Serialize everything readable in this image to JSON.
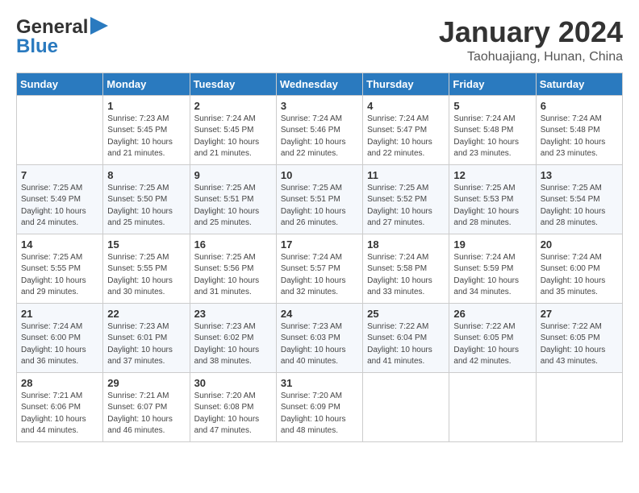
{
  "header": {
    "logo_general": "General",
    "logo_blue": "Blue",
    "month": "January 2024",
    "location": "Taohuajiang, Hunan, China"
  },
  "weekdays": [
    "Sunday",
    "Monday",
    "Tuesday",
    "Wednesday",
    "Thursday",
    "Friday",
    "Saturday"
  ],
  "weeks": [
    [
      {
        "num": "",
        "sunrise": "",
        "sunset": "",
        "daylight": ""
      },
      {
        "num": "1",
        "sunrise": "7:23 AM",
        "sunset": "5:45 PM",
        "daylight": "10 hours and 21 minutes."
      },
      {
        "num": "2",
        "sunrise": "7:24 AM",
        "sunset": "5:45 PM",
        "daylight": "10 hours and 21 minutes."
      },
      {
        "num": "3",
        "sunrise": "7:24 AM",
        "sunset": "5:46 PM",
        "daylight": "10 hours and 22 minutes."
      },
      {
        "num": "4",
        "sunrise": "7:24 AM",
        "sunset": "5:47 PM",
        "daylight": "10 hours and 22 minutes."
      },
      {
        "num": "5",
        "sunrise": "7:24 AM",
        "sunset": "5:48 PM",
        "daylight": "10 hours and 23 minutes."
      },
      {
        "num": "6",
        "sunrise": "7:24 AM",
        "sunset": "5:48 PM",
        "daylight": "10 hours and 23 minutes."
      }
    ],
    [
      {
        "num": "7",
        "sunrise": "7:25 AM",
        "sunset": "5:49 PM",
        "daylight": "10 hours and 24 minutes."
      },
      {
        "num": "8",
        "sunrise": "7:25 AM",
        "sunset": "5:50 PM",
        "daylight": "10 hours and 25 minutes."
      },
      {
        "num": "9",
        "sunrise": "7:25 AM",
        "sunset": "5:51 PM",
        "daylight": "10 hours and 25 minutes."
      },
      {
        "num": "10",
        "sunrise": "7:25 AM",
        "sunset": "5:51 PM",
        "daylight": "10 hours and 26 minutes."
      },
      {
        "num": "11",
        "sunrise": "7:25 AM",
        "sunset": "5:52 PM",
        "daylight": "10 hours and 27 minutes."
      },
      {
        "num": "12",
        "sunrise": "7:25 AM",
        "sunset": "5:53 PM",
        "daylight": "10 hours and 28 minutes."
      },
      {
        "num": "13",
        "sunrise": "7:25 AM",
        "sunset": "5:54 PM",
        "daylight": "10 hours and 28 minutes."
      }
    ],
    [
      {
        "num": "14",
        "sunrise": "7:25 AM",
        "sunset": "5:55 PM",
        "daylight": "10 hours and 29 minutes."
      },
      {
        "num": "15",
        "sunrise": "7:25 AM",
        "sunset": "5:55 PM",
        "daylight": "10 hours and 30 minutes."
      },
      {
        "num": "16",
        "sunrise": "7:25 AM",
        "sunset": "5:56 PM",
        "daylight": "10 hours and 31 minutes."
      },
      {
        "num": "17",
        "sunrise": "7:24 AM",
        "sunset": "5:57 PM",
        "daylight": "10 hours and 32 minutes."
      },
      {
        "num": "18",
        "sunrise": "7:24 AM",
        "sunset": "5:58 PM",
        "daylight": "10 hours and 33 minutes."
      },
      {
        "num": "19",
        "sunrise": "7:24 AM",
        "sunset": "5:59 PM",
        "daylight": "10 hours and 34 minutes."
      },
      {
        "num": "20",
        "sunrise": "7:24 AM",
        "sunset": "6:00 PM",
        "daylight": "10 hours and 35 minutes."
      }
    ],
    [
      {
        "num": "21",
        "sunrise": "7:24 AM",
        "sunset": "6:00 PM",
        "daylight": "10 hours and 36 minutes."
      },
      {
        "num": "22",
        "sunrise": "7:23 AM",
        "sunset": "6:01 PM",
        "daylight": "10 hours and 37 minutes."
      },
      {
        "num": "23",
        "sunrise": "7:23 AM",
        "sunset": "6:02 PM",
        "daylight": "10 hours and 38 minutes."
      },
      {
        "num": "24",
        "sunrise": "7:23 AM",
        "sunset": "6:03 PM",
        "daylight": "10 hours and 40 minutes."
      },
      {
        "num": "25",
        "sunrise": "7:22 AM",
        "sunset": "6:04 PM",
        "daylight": "10 hours and 41 minutes."
      },
      {
        "num": "26",
        "sunrise": "7:22 AM",
        "sunset": "6:05 PM",
        "daylight": "10 hours and 42 minutes."
      },
      {
        "num": "27",
        "sunrise": "7:22 AM",
        "sunset": "6:05 PM",
        "daylight": "10 hours and 43 minutes."
      }
    ],
    [
      {
        "num": "28",
        "sunrise": "7:21 AM",
        "sunset": "6:06 PM",
        "daylight": "10 hours and 44 minutes."
      },
      {
        "num": "29",
        "sunrise": "7:21 AM",
        "sunset": "6:07 PM",
        "daylight": "10 hours and 46 minutes."
      },
      {
        "num": "30",
        "sunrise": "7:20 AM",
        "sunset": "6:08 PM",
        "daylight": "10 hours and 47 minutes."
      },
      {
        "num": "31",
        "sunrise": "7:20 AM",
        "sunset": "6:09 PM",
        "daylight": "10 hours and 48 minutes."
      },
      {
        "num": "",
        "sunrise": "",
        "sunset": "",
        "daylight": ""
      },
      {
        "num": "",
        "sunrise": "",
        "sunset": "",
        "daylight": ""
      },
      {
        "num": "",
        "sunrise": "",
        "sunset": "",
        "daylight": ""
      }
    ]
  ],
  "labels": {
    "sunrise": "Sunrise:",
    "sunset": "Sunset:",
    "daylight": "Daylight:"
  }
}
